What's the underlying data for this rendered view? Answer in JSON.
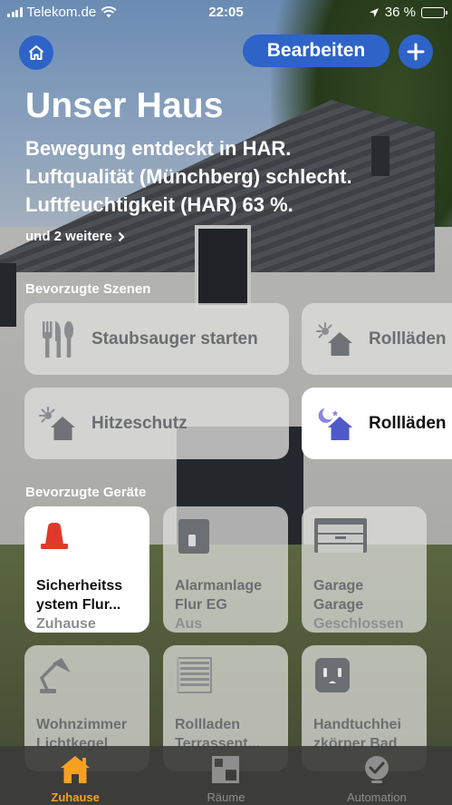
{
  "status_bar": {
    "carrier": "Telekom.de",
    "time": "22:05",
    "battery": "36 %",
    "battery_level": 0.36
  },
  "header": {
    "edit_label": "Bearbeiten",
    "title": "Unser Haus",
    "summary": [
      "Bewegung entdeckt in HAR.",
      "Luftqualität (Münchberg) schlecht.",
      "Luftfeuchtigkeit (HAR) 63 %."
    ],
    "more_label": "und 2 weitere"
  },
  "scenes": {
    "section_title": "Bevorzugte Szenen",
    "items": [
      {
        "label": "Staubsauger starten",
        "icon": "cutlery-icon",
        "active": false
      },
      {
        "label": "Rollläden",
        "icon": "sun-house-icon",
        "active": false
      },
      {
        "label": "Hitzeschutz",
        "icon": "sun-house-icon",
        "active": false
      },
      {
        "label": "Rollläden N",
        "icon": "moon-house-icon",
        "active": true
      }
    ]
  },
  "devices": {
    "section_title": "Bevorzugte Geräte",
    "items": [
      {
        "name": "Sicherheitss ystem Flur...",
        "state": "Zuhause",
        "icon": "siren-icon",
        "active": true
      },
      {
        "name": "Alarmanlage Flur EG",
        "state": "Aus",
        "icon": "sensor-icon",
        "active": false
      },
      {
        "name": "Garage Garage",
        "state": "Geschlossen",
        "icon": "garage-icon",
        "active": false
      },
      {
        "name": "Wohnzimmer Lichtkegel",
        "state": "",
        "icon": "desk-lamp-icon",
        "active": false
      },
      {
        "name": "Rollladen Terrassent...",
        "state": "",
        "icon": "blinds-icon",
        "active": false
      },
      {
        "name": "Handtuchhei zkörper Bad",
        "state": "",
        "icon": "outlet-icon",
        "active": false
      }
    ]
  },
  "tabs": [
    {
      "label": "Zuhause",
      "icon": "house-icon",
      "active": true
    },
    {
      "label": "Räume",
      "icon": "rooms-icon",
      "active": false
    },
    {
      "label": "Automation",
      "icon": "automation-icon",
      "active": false
    }
  ],
  "colors": {
    "accent_blue": "#2e63c8",
    "tab_active": "#f6a022",
    "siren_red": "#e0392b"
  }
}
